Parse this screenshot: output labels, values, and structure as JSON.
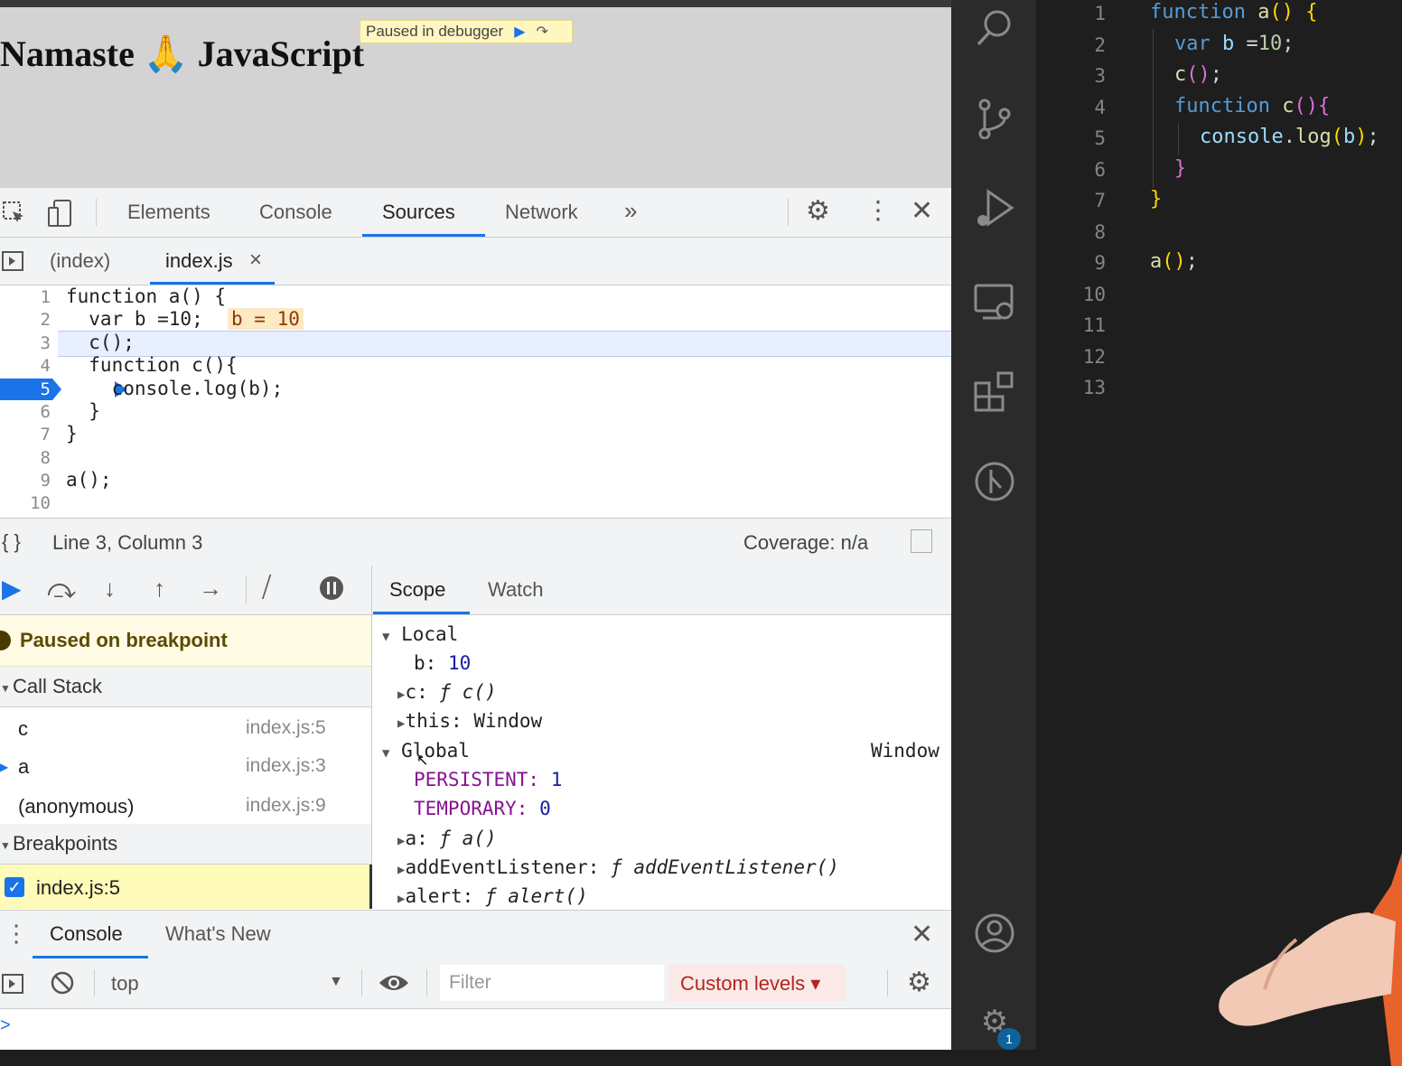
{
  "page": {
    "title": "Namaste 🙏 JavaScript",
    "paused_banner": "Paused in debugger"
  },
  "devtools": {
    "tabs": [
      "Elements",
      "Console",
      "Sources",
      "Network"
    ],
    "active_tab": "Sources",
    "more_tabs": "»",
    "file_tabs": [
      "(index)",
      "index.js"
    ],
    "active_file": "index.js",
    "file_close": "×",
    "code_lines": [
      {
        "num": "1",
        "text": "function a() {"
      },
      {
        "num": "2",
        "text": "  var b =10;"
      },
      {
        "num": "3",
        "text": "  c();"
      },
      {
        "num": "4",
        "text": "  function c(){"
      },
      {
        "num": "5",
        "text": "    console.log(b);"
      },
      {
        "num": "6",
        "text": "  }"
      },
      {
        "num": "7",
        "text": "}"
      },
      {
        "num": "8",
        "text": ""
      },
      {
        "num": "9",
        "text": "a();"
      },
      {
        "num": "10",
        "text": ""
      }
    ],
    "inline_value": "b = 10",
    "breakpoint_line": "5",
    "current_line": "3",
    "status": {
      "format_icon": "{ }",
      "position": "Line 3, Column 3",
      "coverage": "Coverage: n/a"
    },
    "debugger": {
      "paused_message": "Paused on breakpoint",
      "call_stack_label": "Call Stack",
      "call_stack": [
        {
          "name": "c",
          "location": "index.js:5"
        },
        {
          "name": "a",
          "location": "index.js:3"
        },
        {
          "name": "(anonymous)",
          "location": "index.js:9"
        }
      ],
      "breakpoints_label": "Breakpoints",
      "breakpoint_item": "index.js:5"
    },
    "scope": {
      "tabs": [
        "Scope",
        "Watch"
      ],
      "local_label": "Local",
      "b_key": "b:",
      "b_value": "10",
      "c_key": "c:",
      "c_value": "ƒ c()",
      "this_key": "this:",
      "this_value": "Window",
      "global_label": "Global",
      "global_value": "Window",
      "persistent_key": "PERSISTENT:",
      "persistent_value": "1",
      "temporary_key": "TEMPORARY:",
      "temporary_value": "0",
      "a_key": "a:",
      "a_value": "ƒ a()",
      "ael_key": "addEventListener:",
      "ael_value": "ƒ addEventListener()",
      "alert_key": "alert:",
      "alert_value": "ƒ alert()"
    },
    "drawer": {
      "tabs": [
        "Console",
        "What's New"
      ],
      "context": "top",
      "filter_placeholder": "Filter",
      "levels": "Custom levels ▾",
      "prompt": ">"
    }
  },
  "vscode": {
    "line_numbers": [
      "1",
      "2",
      "3",
      "4",
      "5",
      "6",
      "7",
      "8",
      "9",
      "10",
      "11",
      "12",
      "13"
    ],
    "badge": "1"
  }
}
